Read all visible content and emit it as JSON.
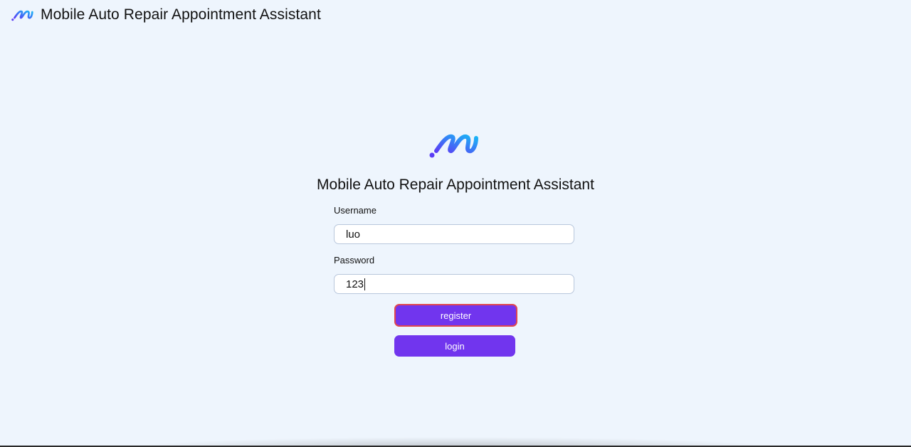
{
  "header": {
    "app_title": "Mobile Auto Repair Appointment Assistant",
    "logo_icon": "brand-logo-icon"
  },
  "login_card": {
    "logo_icon": "brand-logo-icon",
    "title": "Mobile Auto Repair Appointment Assistant",
    "username_label": "Username",
    "username_value": "luo",
    "password_label": "Password",
    "password_value": "123",
    "register_label": "register",
    "login_label": "login"
  },
  "colors": {
    "background": "#eef5fd",
    "button": "#7135ee",
    "focus_ring": "#e0464f",
    "logo_gradient_start": "#5b3df5",
    "logo_gradient_end": "#19b6f6"
  }
}
